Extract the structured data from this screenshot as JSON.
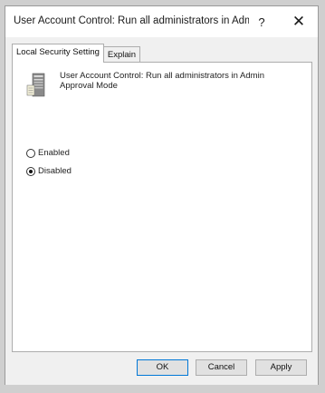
{
  "window": {
    "title": "User Account Control: Run all administrators in Admin Ap...",
    "help_label": "?",
    "close_label": "✕"
  },
  "tabs": [
    {
      "label": "Local Security Setting",
      "active": true
    },
    {
      "label": "Explain",
      "active": false
    }
  ],
  "policy": {
    "name": "User Account Control: Run all administrators in Admin Approval Mode",
    "icon": "policy-server-icon"
  },
  "options": {
    "enabled_label": "Enabled",
    "disabled_label": "Disabled",
    "selected": "Disabled"
  },
  "buttons": {
    "ok_label": "OK",
    "cancel_label": "Cancel",
    "apply_label": "Apply"
  }
}
